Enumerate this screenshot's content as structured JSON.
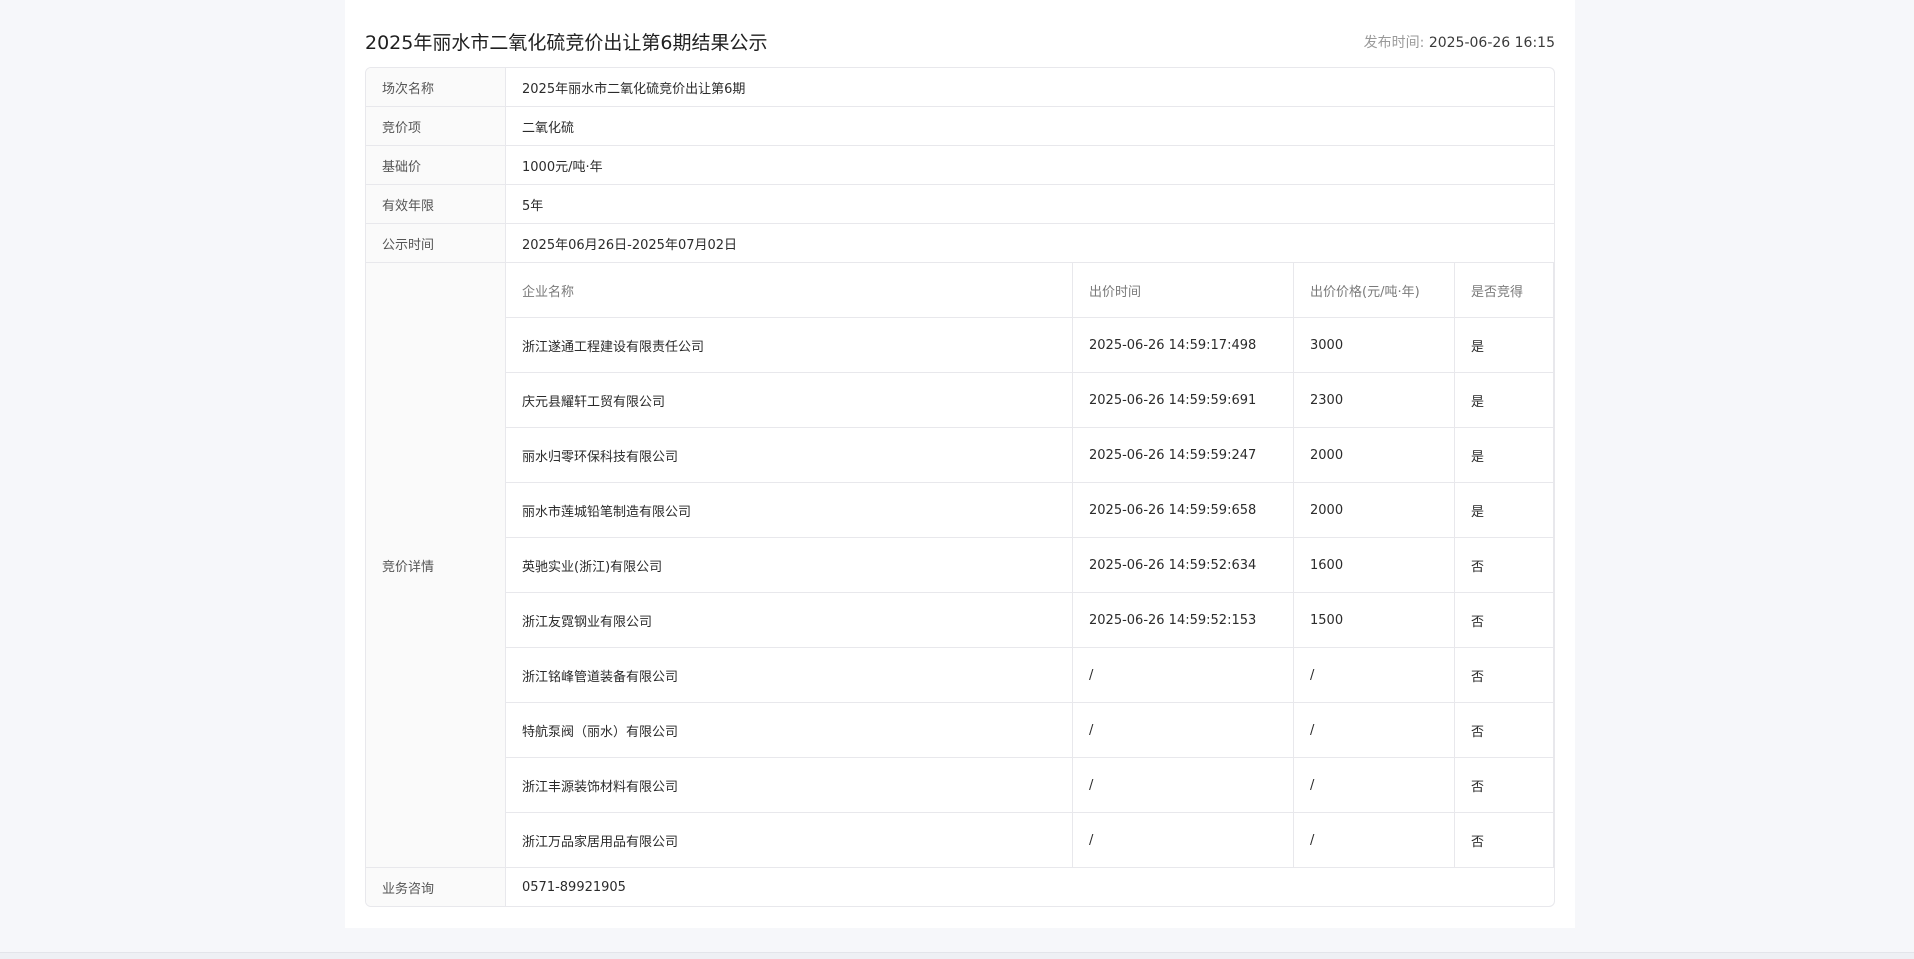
{
  "header": {
    "title": "2025年丽水市二氧化硫竞价出让第6期结果公示",
    "publish_label": "发布时间:",
    "publish_time": "2025-06-26 16:15"
  },
  "info": {
    "session_label": "场次名称",
    "session_value": "2025年丽水市二氧化硫竞价出让第6期",
    "item_label": "竞价项",
    "item_value": "二氧化硫",
    "base_price_label": "基础价",
    "base_price_value": "1000元/吨·年",
    "valid_years_label": "有效年限",
    "valid_years_value": "5年",
    "notice_period_label": "公示时间",
    "notice_period_value": "2025年06月26日-2025年07月02日",
    "detail_label": "竞价详情",
    "consult_label": "业务咨询",
    "consult_value": "0571-89921905"
  },
  "bids": {
    "columns": [
      "企业名称",
      "出价时间",
      "出价价格(元/吨·年)",
      "是否竞得"
    ],
    "rows": [
      [
        "浙江遂通工程建设有限责任公司",
        "2025-06-26 14:59:17:498",
        "3000",
        "是"
      ],
      [
        "庆元县耀轩工贸有限公司",
        "2025-06-26 14:59:59:691",
        "2300",
        "是"
      ],
      [
        "丽水归零环保科技有限公司",
        "2025-06-26 14:59:59:247",
        "2000",
        "是"
      ],
      [
        "丽水市莲城铅笔制造有限公司",
        "2025-06-26 14:59:59:658",
        "2000",
        "是"
      ],
      [
        "英驰实业(浙江)有限公司",
        "2025-06-26 14:59:52:634",
        "1600",
        "否"
      ],
      [
        "浙江友霓钢业有限公司",
        "2025-06-26 14:59:52:153",
        "1500",
        "否"
      ],
      [
        "浙江铭峰管道装备有限公司",
        "/",
        "/",
        "否"
      ],
      [
        "特航泵阀（丽水）有限公司",
        "/",
        "/",
        "否"
      ],
      [
        "浙江丰源装饰材料有限公司",
        "/",
        "/",
        "否"
      ],
      [
        "浙江万品家居用品有限公司",
        "/",
        "/",
        "否"
      ]
    ]
  }
}
